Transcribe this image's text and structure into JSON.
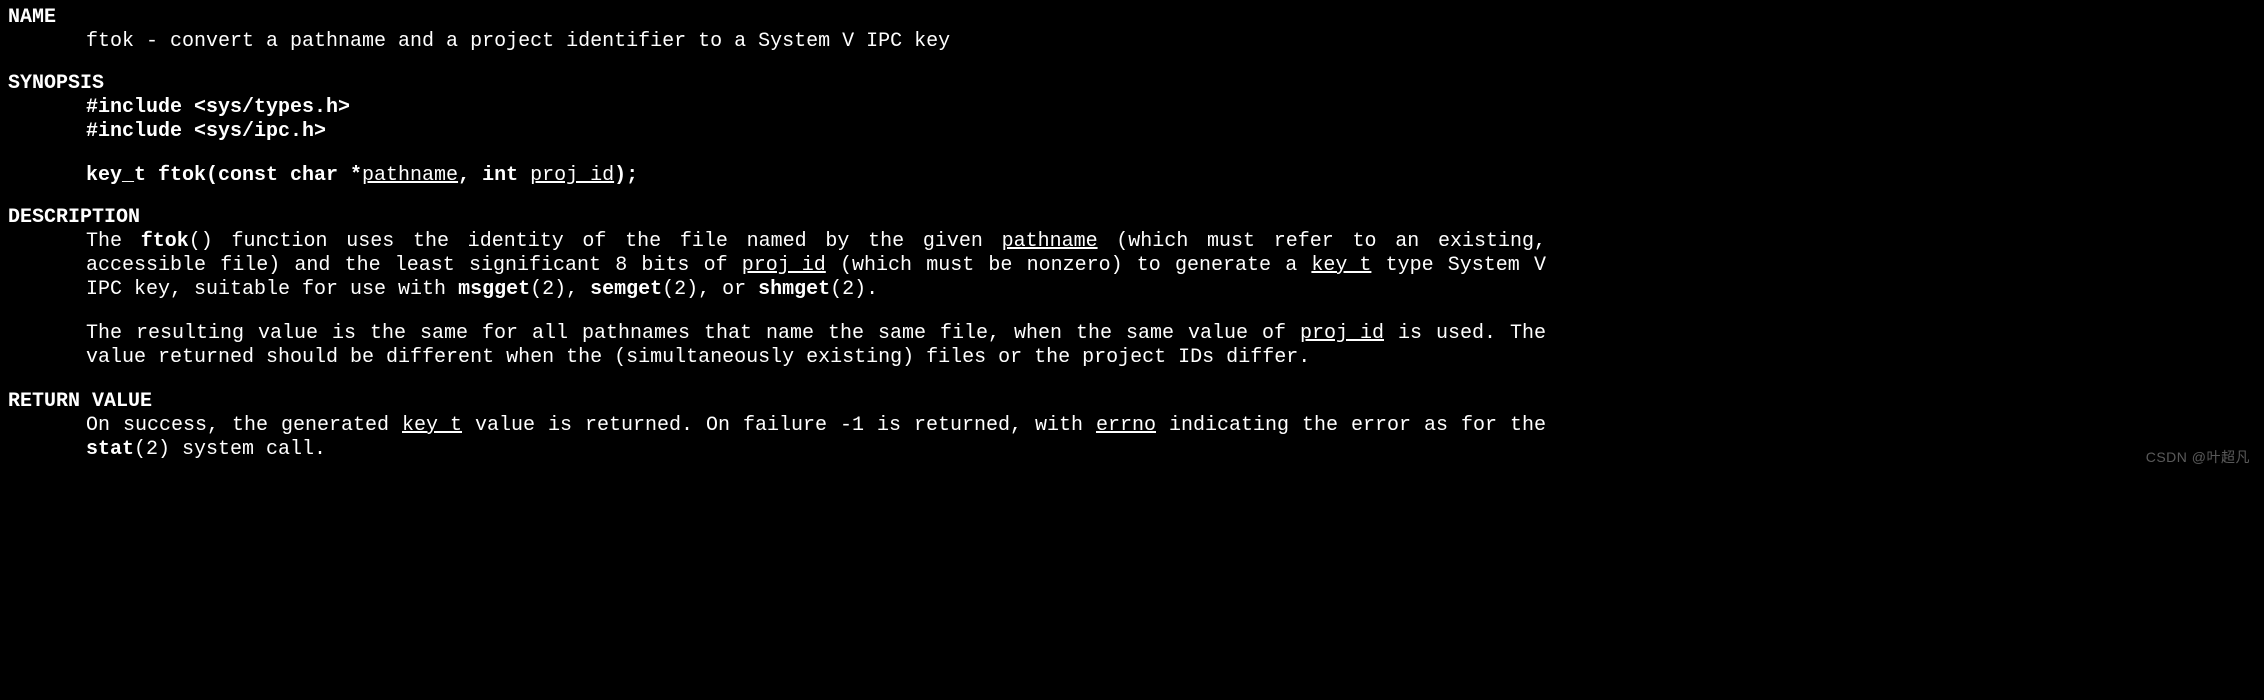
{
  "name": {
    "heading": "NAME",
    "line": "ftok - convert a pathname and a project identifier to a System V IPC key"
  },
  "synopsis": {
    "heading": "SYNOPSIS",
    "inc1": "#include <sys/types.h>",
    "inc2": "#include <sys/ipc.h>",
    "proto_lead": "key_t ftok(const char *",
    "proto_arg1": "pathname",
    "proto_mid": ", int ",
    "proto_arg2": "proj_id",
    "proto_tail": ");"
  },
  "description": {
    "heading": "DESCRIPTION",
    "p1_a": "The  ",
    "p1_b": "ftok",
    "p1_c": "()  function  uses the identity of the file named by the given ",
    "p1_d": "pathname",
    "p1_e": " (which must refer to an existing, accessible file) and the least significant 8 bits of ",
    "p1_f": "proj_id",
    "p1_g": " (which must be nonzero) to generate a ",
    "p1_h": "key_t",
    "p1_i": " type System V IPC key, suitable for use with ",
    "p1_j": "msgget",
    "p1_k": "(2), ",
    "p1_l": "semget",
    "p1_m": "(2), or ",
    "p1_n": "shmget",
    "p1_o": "(2).",
    "p2_a": "The resulting value is the same for all pathnames that name the same file, when the same value of ",
    "p2_b": "proj_id",
    "p2_c": " is used.  The value returned should be different when the (simultaneously existing) files or the project IDs differ."
  },
  "return": {
    "heading": "RETURN VALUE",
    "p_a": "On success, the generated ",
    "p_b": "key_t",
    "p_c": " value is returned.  On failure -1 is returned, with ",
    "p_d": "errno",
    "p_e": " indicating the  error  as  for  the ",
    "p_f": "stat",
    "p_g": "(2) system call."
  },
  "watermark": "CSDN @叶超凡"
}
